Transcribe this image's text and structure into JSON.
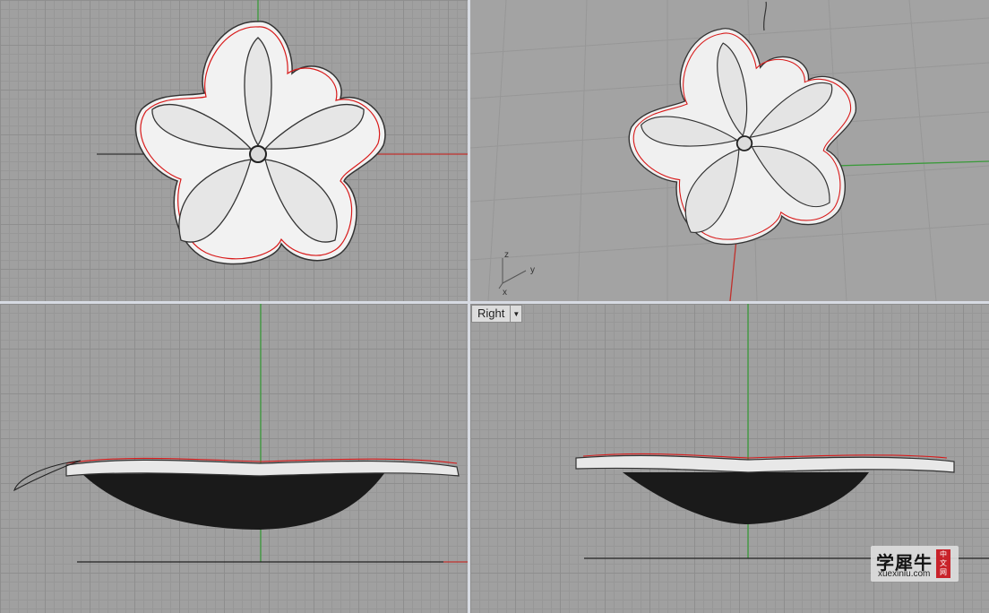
{
  "viewports": {
    "right": {
      "label": "Right"
    }
  },
  "persp_axes": {
    "z": "z",
    "y": "y",
    "x": "x"
  },
  "icons": {
    "dropdown": "triangle-down-icon"
  },
  "watermark": {
    "title": "学犀牛",
    "url": "xuexiniu.com",
    "badge": "中\n文\n网"
  },
  "colors": {
    "x_axis": "#c0302c",
    "y_axis": "#3a9a3a",
    "curve": "#d81a1a"
  }
}
